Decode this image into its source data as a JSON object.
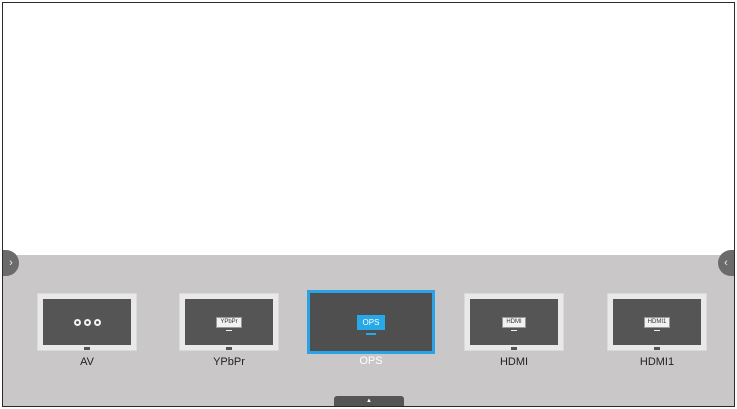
{
  "nav": {
    "prev_icon": "›",
    "next_icon": "‹"
  },
  "sources": [
    {
      "label": "AV",
      "icon": "av-connectors-icon",
      "screen_text": ""
    },
    {
      "label": "YPbPr",
      "icon": "ypbpr-icon",
      "screen_text": "YPbPr"
    },
    {
      "label": "OPS",
      "icon": "ops-icon",
      "screen_text": "OPS",
      "selected": true
    },
    {
      "label": "HDMI",
      "icon": "hdmi-icon",
      "screen_text": "HDMI"
    },
    {
      "label": "HDMI1",
      "icon": "hdmi-icon",
      "screen_text": "HDMI1"
    }
  ],
  "collapse": {
    "icon": "▲"
  },
  "colors": {
    "accent": "#2aa3e6",
    "panel_bg": "#c9c7c7",
    "tile_screen": "#555555"
  }
}
